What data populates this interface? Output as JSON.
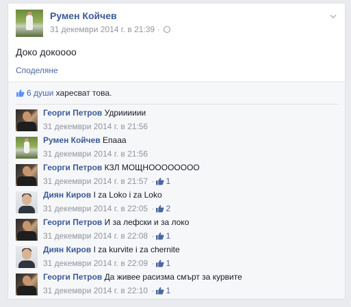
{
  "post": {
    "author": "Румен Койчев",
    "timestamp": "31 декември 2014 г. в 21:39",
    "meta_separator": "·",
    "text": "Доко докоооо",
    "share_label": "Споделяне"
  },
  "likes": {
    "count_label": "6 души",
    "suffix": " харесват това."
  },
  "comments": [
    {
      "author": "Георги Петров",
      "text": "Удрииииии",
      "timestamp": "31 декември 2014 г. в 21:56",
      "likes": "",
      "avatar": "georgi"
    },
    {
      "author": "Румен Койчев",
      "text": "Епааа",
      "timestamp": "31 декември 2014 г. в 21:56",
      "likes": "",
      "avatar": "rumen"
    },
    {
      "author": "Георги Петров",
      "text": "КЗЛ МОЩНОООООООО",
      "timestamp": "31 декември 2014 г. в 21:57",
      "likes": "1",
      "avatar": "georgi"
    },
    {
      "author": "Диян Киров",
      "text": "I za Loko i za Loko",
      "timestamp": "31 декември 2014 г. в 22:05",
      "likes": "2",
      "avatar": "diyan"
    },
    {
      "author": "Георги Петров",
      "text": "И за лефски и за локо",
      "timestamp": "31 декември 2014 г. в 22:08",
      "likes": "1",
      "avatar": "georgi"
    },
    {
      "author": "Диян Киров",
      "text": "I za kurvite i za chernite",
      "timestamp": "31 декември 2014 г. в 22:09",
      "likes": "1",
      "avatar": "diyan"
    },
    {
      "author": "Георги Петров",
      "text": "Да живее расизма смърт за курвите",
      "timestamp": "31 декември 2014 г. в 22:10",
      "likes": "1",
      "avatar": "georgi"
    }
  ],
  "colors": {
    "link": "#3b5998",
    "meta": "#90949c",
    "background": "#e9ebee",
    "ufi_background": "#f6f7f9"
  },
  "icons": [
    "globe-icon",
    "chevron-down-icon",
    "thumbs-up-icon"
  ]
}
